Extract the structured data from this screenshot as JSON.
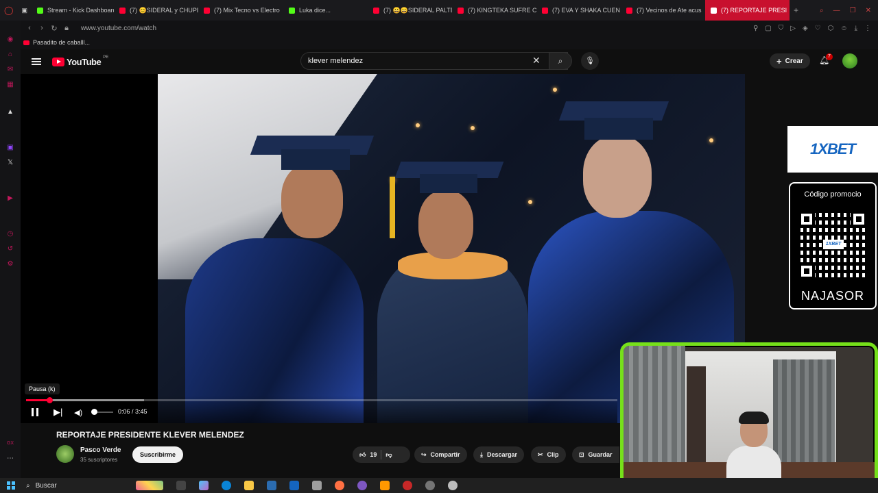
{
  "browser": {
    "tabs": [
      {
        "label": "Stream - Kick Dashboard",
        "fav": "kick"
      },
      {
        "label": "(7) 😊SIDERAL y CHUPE",
        "fav": "yt"
      },
      {
        "label": "(7) Mix Tecno vs Electro",
        "fav": "yt"
      },
      {
        "label": "Luka dice...",
        "fav": "kick"
      },
      {
        "label": "(7) 😀😀SIDERAL PALTE",
        "fav": "yt"
      },
      {
        "label": "(7) KINGTEKA SUFRE C",
        "fav": "yt"
      },
      {
        "label": "(7) EVA Y SHAKA CUEN",
        "fav": "yt"
      },
      {
        "label": "(7) Vecinos de Ate acus",
        "fav": "yt"
      },
      {
        "label": "(7) REPORTAJE PRESI",
        "fav": "yt",
        "active": true
      }
    ],
    "url": "www.youtube.com/watch",
    "bookmark": "Pasadito de caballl..."
  },
  "youtube": {
    "logo_text": "YouTube",
    "country": "PE",
    "search_value": "klever melendez",
    "create_label": "Crear",
    "notif_count": "7"
  },
  "player": {
    "tooltip": "Pausa (k)",
    "time": "0:06 / 3:45",
    "progress": 0.039
  },
  "ads": {
    "brand": "1XBET",
    "promo_title": "Código promocio",
    "promo_code": "NAJASOR",
    "qr_label": "1XBET"
  },
  "video": {
    "title": "REPORTAJE PRESIDENTE KLEVER MELENDEZ",
    "channel": "Pasco Verde",
    "subscribers": "35 suscriptores",
    "subscribe_label": "Suscribirme",
    "likes": "19",
    "share_label": "Compartir",
    "download_label": "Descargar",
    "clip_label": "Clip",
    "save_label": "Guardar"
  },
  "taskbar": {
    "search_label": "Buscar"
  },
  "colors": {
    "yt_red": "#ff0033",
    "webcam_border": "#76e01a",
    "opera_accent": "#c2185b"
  }
}
